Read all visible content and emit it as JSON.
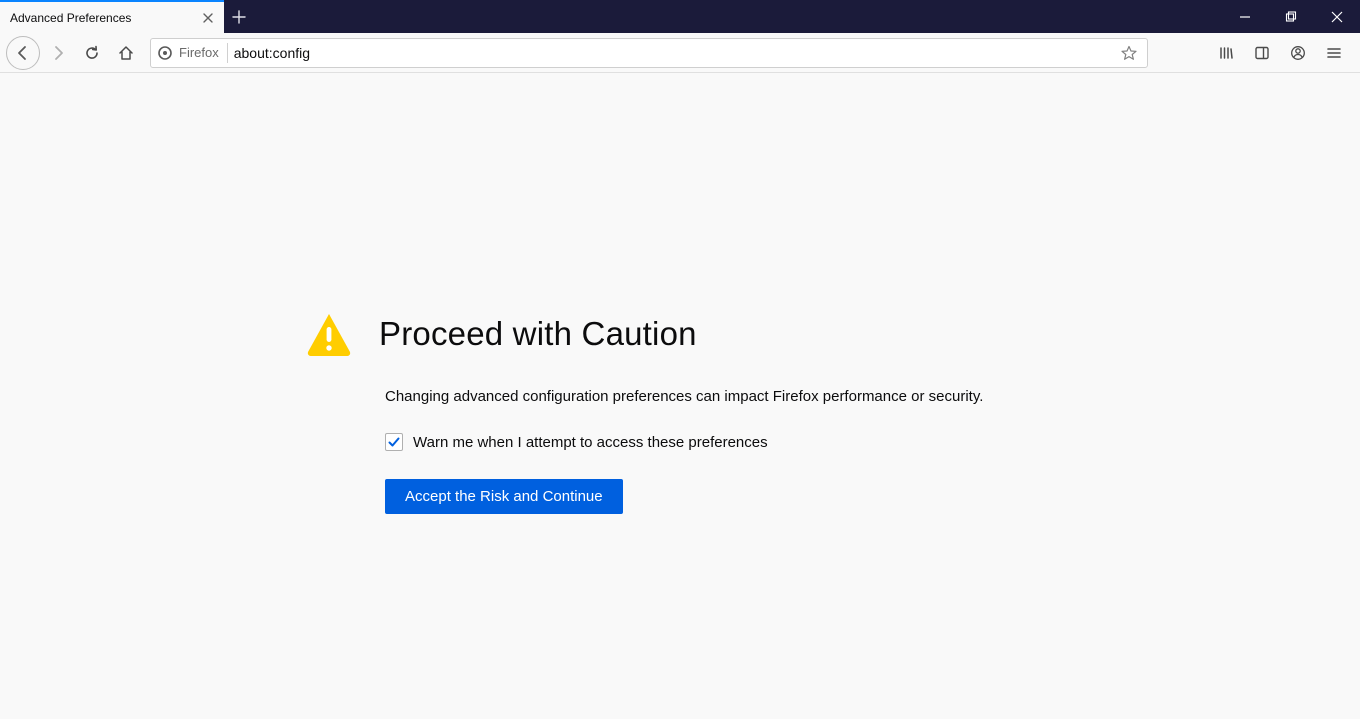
{
  "tab": {
    "title": "Advanced Preferences"
  },
  "urlbar": {
    "identity_label": "Firefox",
    "url": "about:config"
  },
  "page": {
    "title": "Proceed with Caution",
    "description": "Changing advanced configuration preferences can impact Firefox performance or security.",
    "checkbox_label": "Warn me when I attempt to access these preferences",
    "checkbox_checked": true,
    "accept_button": "Accept the Risk and Continue"
  },
  "colors": {
    "accent_blue": "#0060df",
    "tab_highlight": "#0a84ff",
    "warning_yellow": "#ffcd00",
    "titlebar_bg": "#1b1b3a"
  }
}
